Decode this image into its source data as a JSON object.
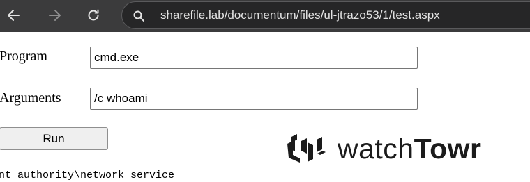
{
  "browser": {
    "url": "sharefile.lab/documentum/files/ul-jtrazo53/1/test.aspx",
    "icons": [
      "back-arrow-icon",
      "forward-arrow-icon",
      "reload-icon",
      "search-icon"
    ]
  },
  "form": {
    "program_label": "Program",
    "program_value": "cmd.exe",
    "arguments_label": "Arguments",
    "arguments_value": "/c whoami",
    "run_label": "Run"
  },
  "output": {
    "text": "nt authority\\network service"
  },
  "logo": {
    "text_light": "watch",
    "text_bold": "Towr"
  }
}
